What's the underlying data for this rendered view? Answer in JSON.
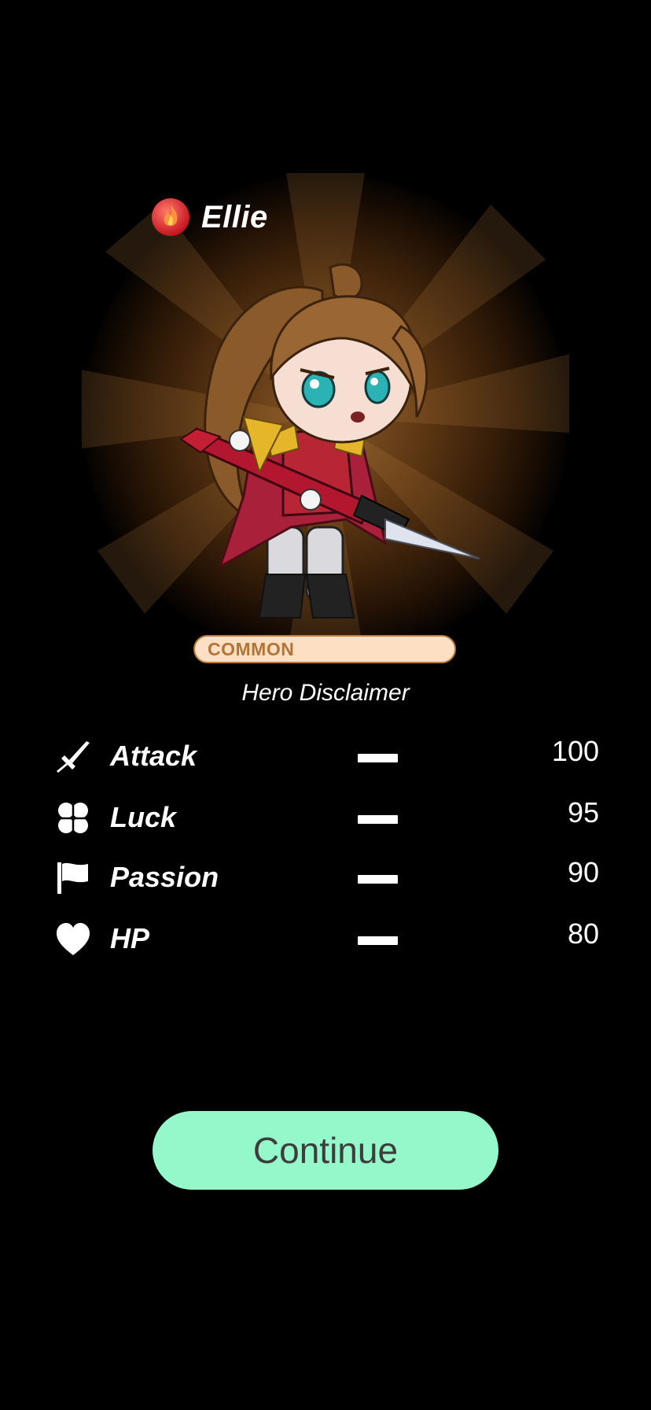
{
  "hero": {
    "name": "Ellie",
    "element_icon": "fire-icon",
    "rarity": "COMMON",
    "disclaimer": "Hero Disclaimer"
  },
  "stats": [
    {
      "label": "Attack",
      "icon": "sword-icon",
      "value": "100"
    },
    {
      "label": "Luck",
      "icon": "clover-icon",
      "value": "95"
    },
    {
      "label": "Passion",
      "icon": "flag-icon",
      "value": "90"
    },
    {
      "label": "HP",
      "icon": "heart-icon",
      "value": "80"
    }
  ],
  "actions": {
    "continue_label": "Continue"
  },
  "colors": {
    "background": "#000000",
    "continue_button": "#94f8cb",
    "rarity_fill": "#fde0c3",
    "rarity_text": "#b47438"
  }
}
